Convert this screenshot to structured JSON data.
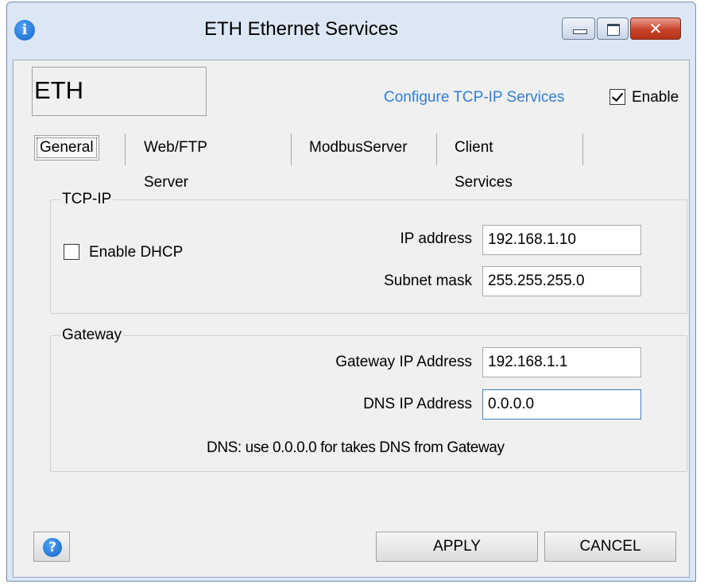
{
  "window": {
    "title": "ETH Ethernet Services",
    "title_icon": "info-icon",
    "controls": {
      "minimize": "minimize-icon",
      "maximize": "maximize-icon",
      "close": "close-icon",
      "close_glyph": "✕"
    }
  },
  "header": {
    "device_name": "ETH",
    "configure_link": "Configure TCP-IP Services",
    "enable_label": "Enable",
    "enable_checked": true
  },
  "tabs": [
    {
      "label": "General",
      "active": true
    },
    {
      "label": "Web/FTP Server",
      "active": false
    },
    {
      "label": "ModbusServer",
      "active": false
    },
    {
      "label": "Client Services",
      "active": false
    }
  ],
  "tcpip": {
    "group_title": "TCP-IP",
    "dhcp_label": "Enable DHCP",
    "dhcp_checked": false,
    "ip_label": "IP address",
    "ip_value": "192.168.1.10",
    "subnet_label": "Subnet mask",
    "subnet_value": "255.255.255.0"
  },
  "gateway": {
    "group_title": "Gateway",
    "gateway_ip_label": "Gateway IP Address",
    "gateway_ip_value": "192.168.1.1",
    "dns_ip_label": "DNS IP Address",
    "dns_ip_value": "0.0.0.0",
    "note": "DNS: use 0.0.0.0 for takes DNS from Gateway"
  },
  "footer": {
    "help_icon": "help-icon",
    "help_glyph": "?",
    "apply_label": "APPLY",
    "cancel_label": "CANCEL"
  },
  "colors": {
    "link": "#2f7fd6",
    "titlebar": "#dbe7f5",
    "close_button": "#c8432b",
    "focus_border": "#3d7fc6"
  }
}
